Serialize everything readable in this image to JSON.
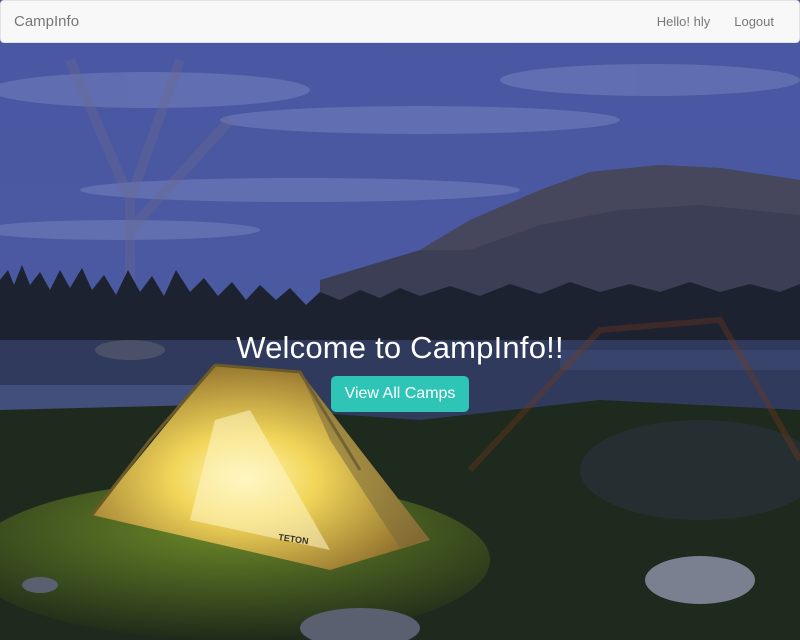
{
  "navbar": {
    "brand": "CampInfo",
    "greeting": "Hello! hly",
    "logout_label": "Logout"
  },
  "hero": {
    "heading": "Welcome to CampInfo!!",
    "cta_label": "View All Camps",
    "tent_brand": "TETON"
  },
  "colors": {
    "cta": "#2ec4b6",
    "navbar_bg": "#f8f8f8",
    "navbar_text": "#777777",
    "sky_overlay": "#3b4790"
  }
}
